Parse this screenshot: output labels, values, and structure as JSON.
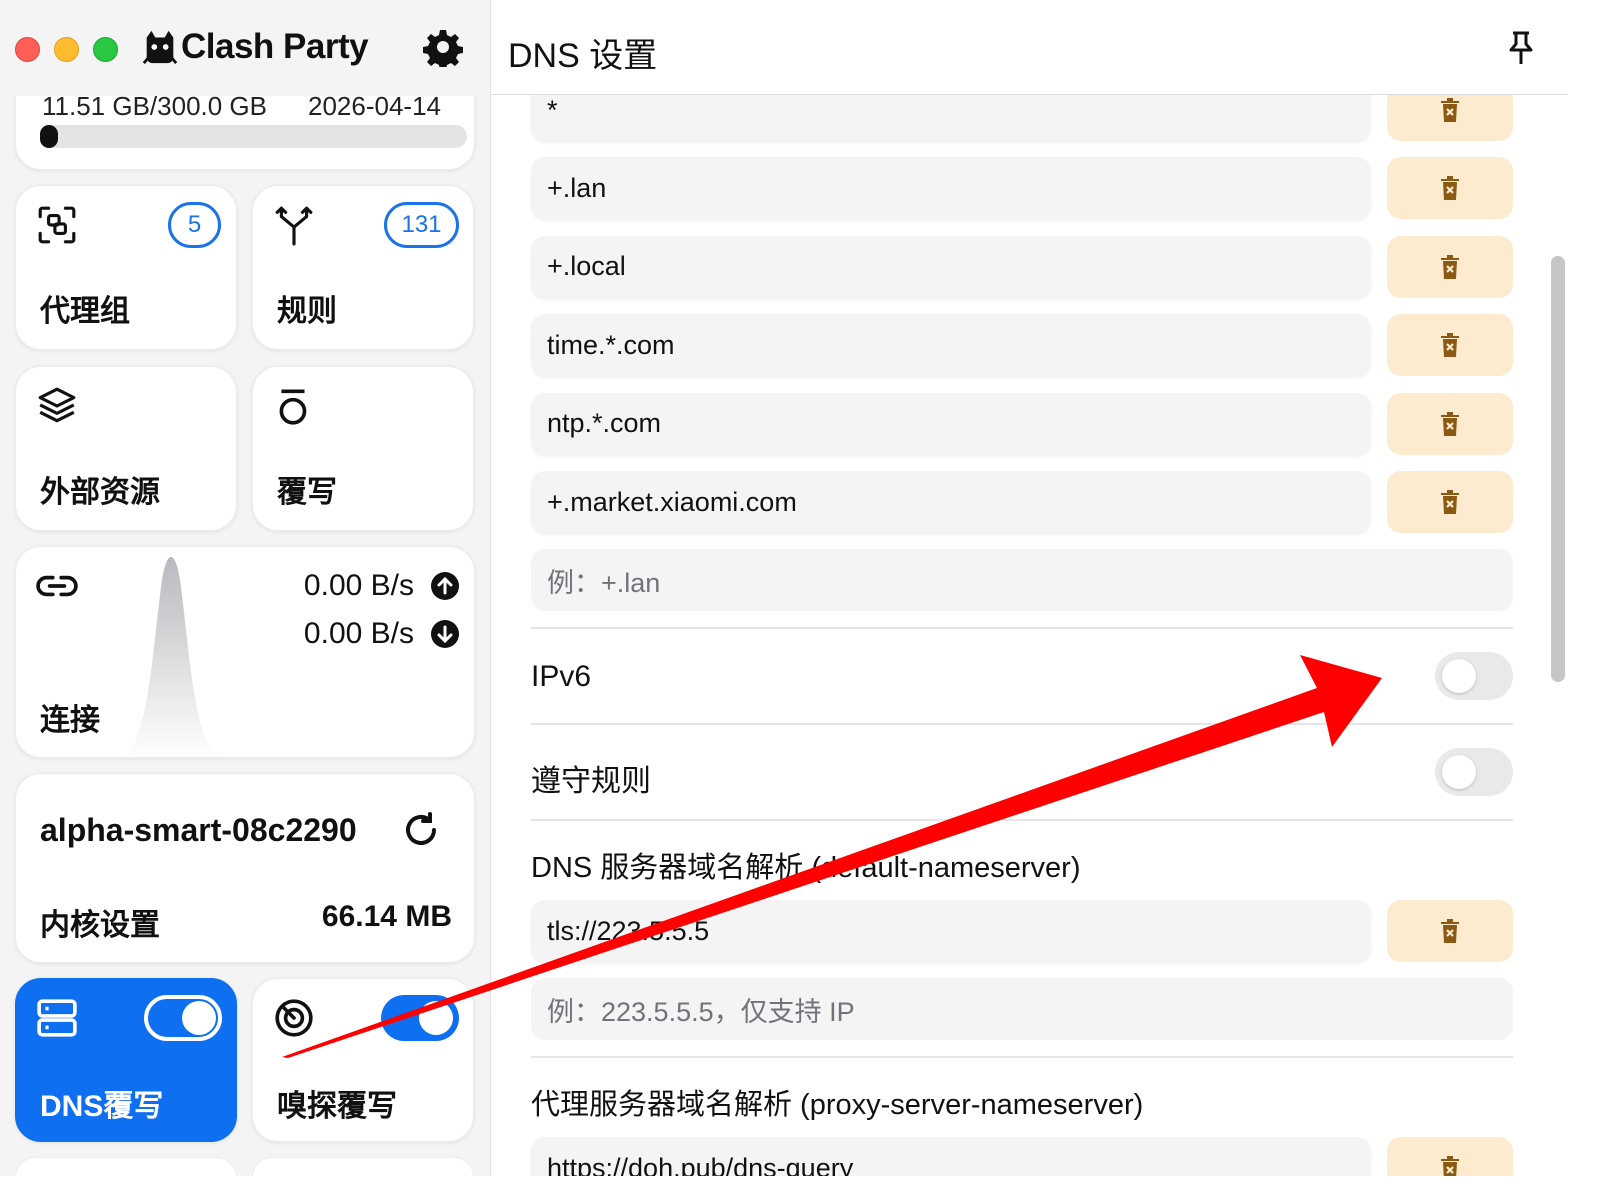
{
  "app": {
    "title": "Clash Party"
  },
  "sidebar": {
    "traffic": {
      "used": "11.51 GB/300.0 GB",
      "expire": "2026-04-14",
      "progress_percent": 4
    },
    "proxy_groups": {
      "label": "代理组",
      "count": "5"
    },
    "rules": {
      "label": "规则",
      "count": "131"
    },
    "resources": {
      "label": "外部资源"
    },
    "override": {
      "label": "覆写"
    },
    "connections": {
      "label": "连接",
      "upload": "0.00 B/s",
      "download": "0.00 B/s"
    },
    "core": {
      "name": "alpha-smart-08c2290",
      "label": "内核设置",
      "memory": "66.14 MB"
    },
    "dns": {
      "label": "DNS覆写",
      "enabled": true
    },
    "sniff": {
      "label": "嗅探覆写",
      "enabled": true
    }
  },
  "main": {
    "title": "DNS 设置",
    "fake_ip_filter": {
      "items": [
        "*",
        "+.lan",
        "+.local",
        "time.*.com",
        "ntp.*.com",
        "+.market.xiaomi.com"
      ],
      "placeholder": "例：+.lan"
    },
    "ipv6": {
      "label": "IPv6",
      "enabled": false
    },
    "respect_rules": {
      "label": "遵守规则",
      "enabled": false
    },
    "default_nameserver": {
      "label": "DNS 服务器域名解析 (default-nameserver)",
      "items": [
        "tls://223.5.5.5"
      ],
      "placeholder": "例：223.5.5.5，仅支持 IP"
    },
    "proxy_server_nameserver": {
      "label": "代理服务器域名解析 (proxy-server-nameserver)",
      "items": [
        "https://doh.pub/dns-query"
      ]
    }
  },
  "colors": {
    "accent": "#0e6ff0",
    "delete_bg": "#fdebd0",
    "delete_icon": "#8a5a14",
    "annotation_arrow": "#ff0000"
  },
  "icons": {
    "settings": "gear-icon",
    "proxy_groups": "scan-icon",
    "rules": "fork-icon",
    "resources": "layers-icon",
    "override": "override-icon",
    "connections": "link-icon",
    "core_refresh": "refresh-icon",
    "dns": "server-icon",
    "sniff": "radar-icon",
    "pin": "pin-icon",
    "delete": "trash-icon"
  }
}
